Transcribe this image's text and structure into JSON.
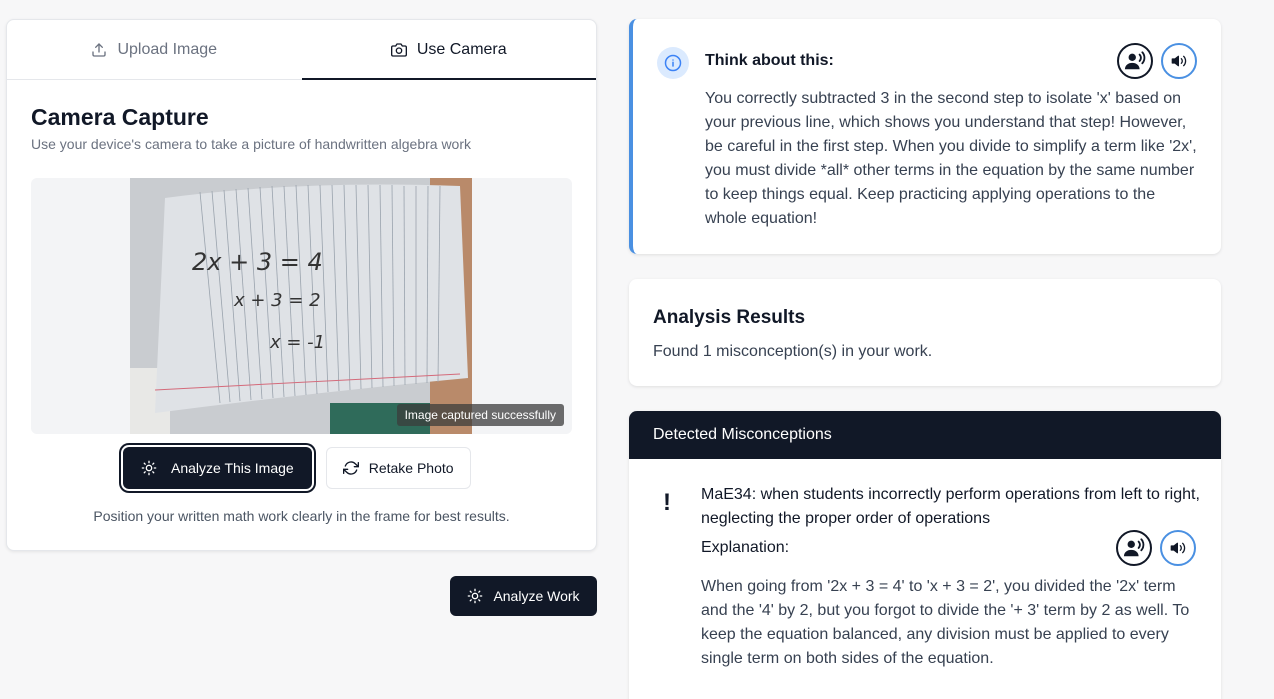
{
  "tabs": {
    "upload": "Upload Image",
    "camera": "Use Camera",
    "active": "camera"
  },
  "capture": {
    "title": "Camera Capture",
    "subtitle": "Use your device's camera to take a picture of handwritten algebra work",
    "badge": "Image captured successfully",
    "handwriting": [
      "2x + 3 = 4",
      "x + 3 = 2",
      "x = -1"
    ],
    "analyze_button": "Analyze This Image",
    "retake_button": "Retake Photo",
    "hint": "Position your written math work clearly in the frame for best results."
  },
  "analyze_work_button": "Analyze Work",
  "think": {
    "title": "Think about this:",
    "body": "You correctly subtracted 3 in the second step to isolate 'x' based on your previous line, which shows you understand that step! However, be careful in the first step. When you divide to simplify a term like '2x', you must divide *all* other terms in the equation by the same number to keep things equal. Keep practicing applying operations to the whole equation!"
  },
  "results": {
    "title": "Analysis Results",
    "text": "Found 1 misconception(s) in your work."
  },
  "misconceptions": {
    "header": "Detected Misconceptions",
    "items": [
      {
        "marker": "!",
        "title": "MaE34: when students incorrectly perform operations from left to right, neglecting the proper order of operations",
        "explanation_label": "Explanation:",
        "explanation": "When going from '2x + 3 = 4' to 'x + 3 = 2', you divided the '2x' term and the '4' by 2, but you forgot to divide the '+ 3' term by 2 as well. To keep the equation balanced, any division must be applied to every single term on both sides of the equation."
      }
    ]
  },
  "colors": {
    "dark": "#111827",
    "accent": "#4a90e2",
    "info_bg": "#dbeafe"
  }
}
